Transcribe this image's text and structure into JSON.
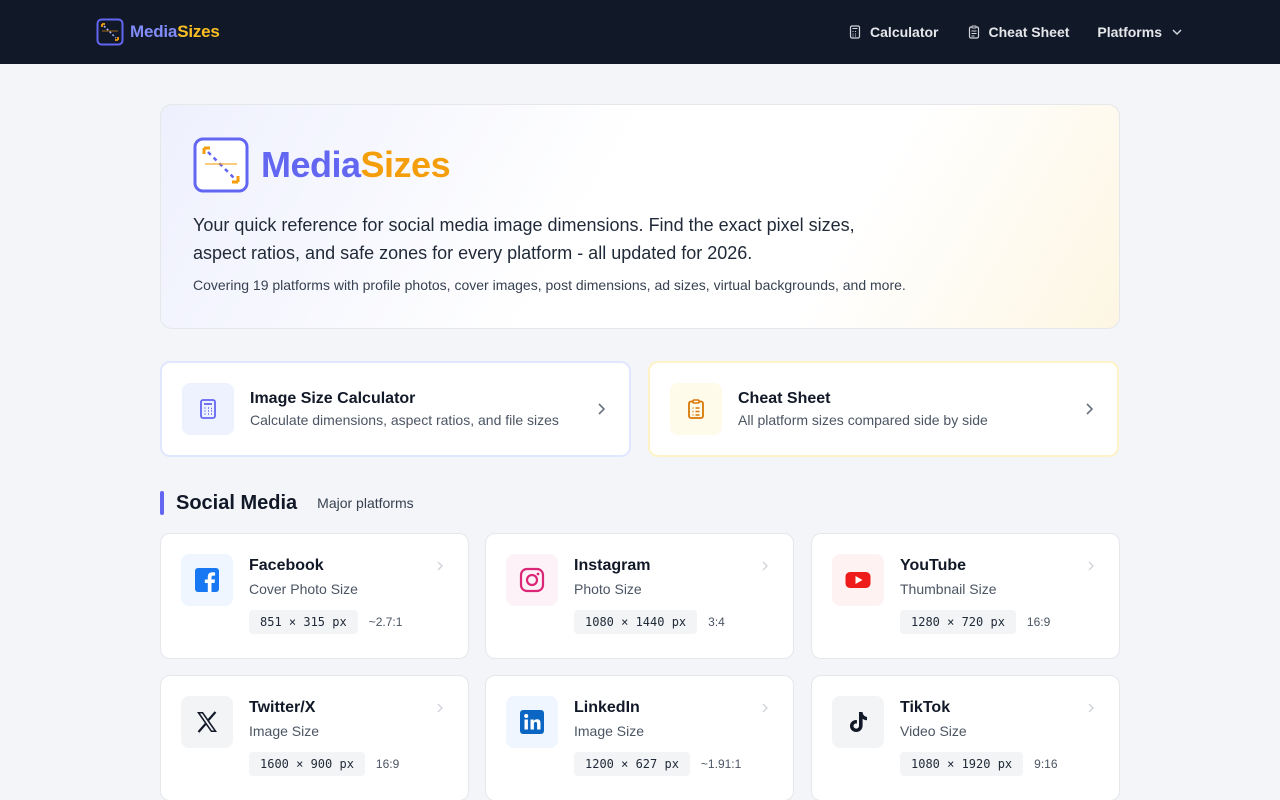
{
  "header": {
    "brand_part1": "Media",
    "brand_part2": "Sizes",
    "nav": [
      {
        "label": "Calculator",
        "icon": "calculator-icon"
      },
      {
        "label": "Cheat Sheet",
        "icon": "clipboard-icon"
      },
      {
        "label": "Platforms",
        "icon": "chevron-down-icon"
      }
    ]
  },
  "hero": {
    "title_part1": "Media",
    "title_part2": "Sizes",
    "description": "Your quick reference for social media image dimensions. Find the exact pixel sizes, aspect ratios, and safe zones for every platform - all updated for 2026.",
    "subtext": "Covering 19 platforms with profile photos, cover images, post dimensions, ad sizes, virtual backgrounds, and more."
  },
  "tools": {
    "calculator": {
      "title": "Image Size Calculator",
      "subtitle": "Calculate dimensions, aspect ratios, and file sizes"
    },
    "cheatsheet": {
      "title": "Cheat Sheet",
      "subtitle": "All platform sizes compared side by side"
    }
  },
  "section": {
    "title": "Social Media",
    "subtitle": "Major platforms"
  },
  "platforms": [
    {
      "name": "Facebook",
      "type": "Cover Photo Size",
      "dimensions": "851 × 315 px",
      "ratio": "~2.7:1"
    },
    {
      "name": "Instagram",
      "type": "Photo Size",
      "dimensions": "1080 × 1440 px",
      "ratio": "3:4"
    },
    {
      "name": "YouTube",
      "type": "Thumbnail Size",
      "dimensions": "1280 × 720 px",
      "ratio": "16:9"
    },
    {
      "name": "Twitter/X",
      "type": "Image Size",
      "dimensions": "1600 × 900 px",
      "ratio": "16:9"
    },
    {
      "name": "LinkedIn",
      "type": "Image Size",
      "dimensions": "1200 × 627 px",
      "ratio": "~1.91:1"
    },
    {
      "name": "TikTok",
      "type": "Video Size",
      "dimensions": "1080 × 1920 px",
      "ratio": "9:16"
    }
  ],
  "colors": {
    "header_bg": "#111827",
    "accent_indigo": "#6366f1",
    "accent_amber": "#f59e0b"
  }
}
